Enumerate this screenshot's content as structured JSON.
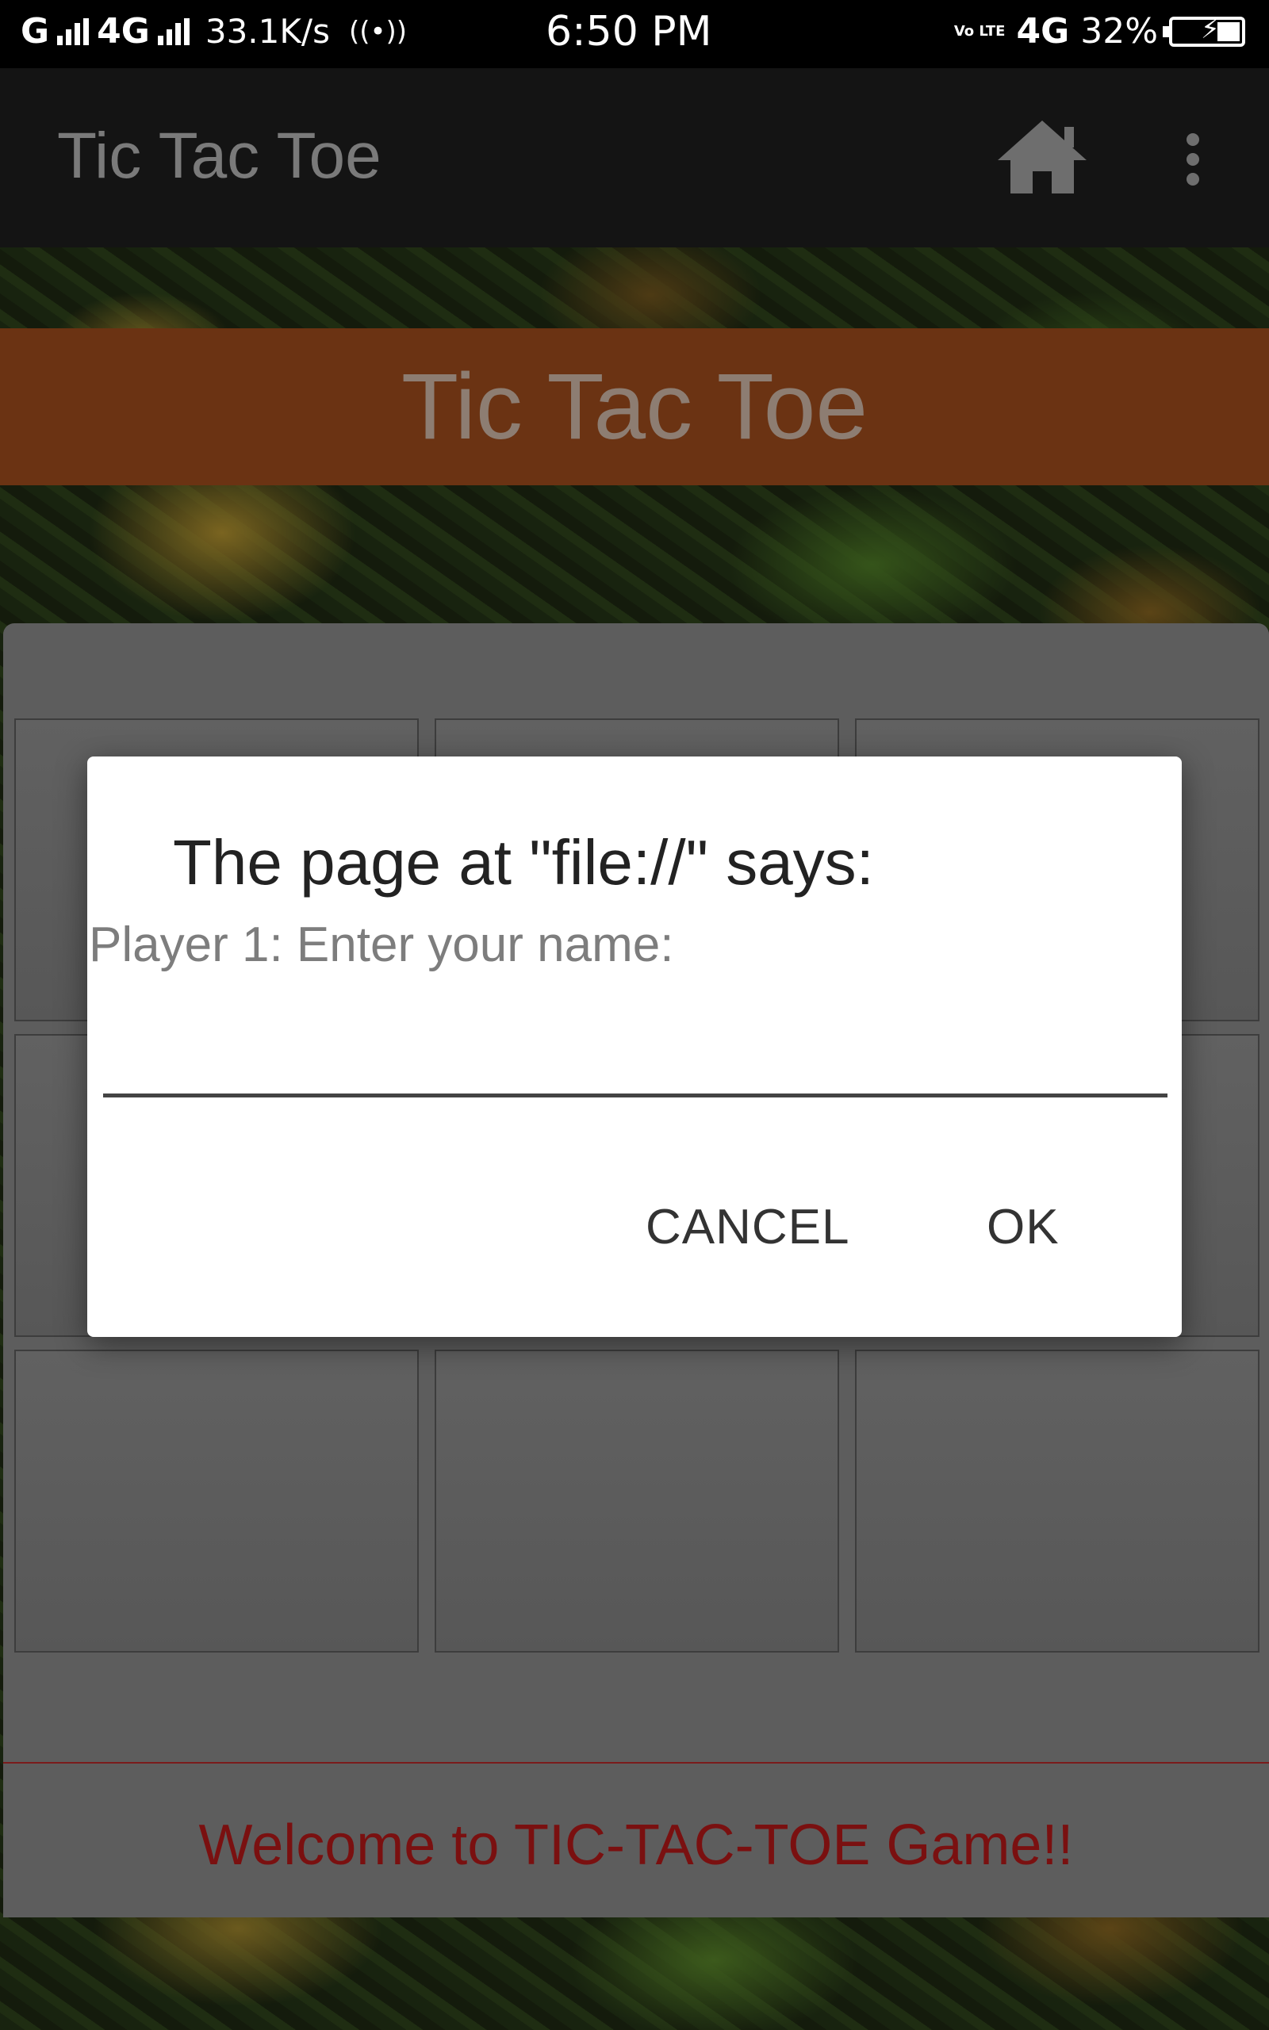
{
  "status_bar": {
    "left_network": "G",
    "left_network_2": "4G",
    "speed": "33.1K/s",
    "time": "6:50 PM",
    "volte": "Vo LTE",
    "network_right": "4G",
    "battery": "32%",
    "battery_level": 0.32
  },
  "app_bar": {
    "title": "Tic Tac Toe",
    "home_icon": "home-icon",
    "overflow_icon": "more-vert-icon"
  },
  "page": {
    "header_title": "Tic Tac Toe",
    "welcome_text": "Welcome to TIC-TAC-TOE Game!!",
    "board_cells": [
      "",
      "",
      "",
      "",
      "",
      "",
      "",
      "",
      ""
    ]
  },
  "dialog": {
    "title": "The page at \"file://\" says:",
    "message": "Player 1: Enter your name:",
    "input_value": "",
    "cancel_label": "CANCEL",
    "ok_label": "OK"
  },
  "colors": {
    "header_band": "#6b3313",
    "welcome_text": "#7a1010",
    "panel": "#5d5d5d"
  }
}
